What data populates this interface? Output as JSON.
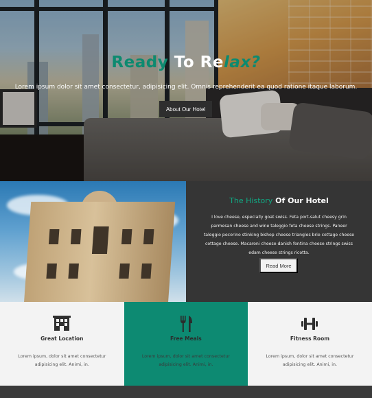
{
  "hero": {
    "title_part1": "Ready",
    "title_part2": " To ",
    "title_part3": "Re",
    "title_part4": "lax?",
    "subtitle": "Lorem ipsum dolor sit amet consectetur, adipisicing elit. Omnis reprehenderit ea quod ratione itaque laborum.",
    "button_label": "About Our Hotel"
  },
  "history": {
    "title_accent": "The History",
    "title_rest": " Of Our Hotel",
    "body": "I love cheese, especially goat swiss. Feta port-salut cheesy grin parmesan cheese and wine taleggio feta cheese strings. Paneer taleggio pecorino stinking bishop cheese triangles brie cottage cheese cottage cheese. Macaroni cheese danish fontina cheese strings swiss edam cheese strings ricotta.",
    "button_label": "Read More"
  },
  "features": [
    {
      "icon": "building-icon",
      "title": "Great Location",
      "text": "Lorem ipsum, dolor sit amet consectetur adipisicing elit. Animi, in."
    },
    {
      "icon": "utensils-icon",
      "title": "Free Meals",
      "text": "Lorem ipsum, dolor sit amet consectetur adipisicing elit. Animi, in."
    },
    {
      "icon": "dumbbell-icon",
      "title": "Fitness Room",
      "text": "Lorem ipsum, dolor sit amet consectetur adipisicing elit. Animi, in."
    }
  ],
  "colors": {
    "accent": "#0d8a72",
    "dark_panel": "#353535",
    "light_bg": "#f3f3f3"
  }
}
